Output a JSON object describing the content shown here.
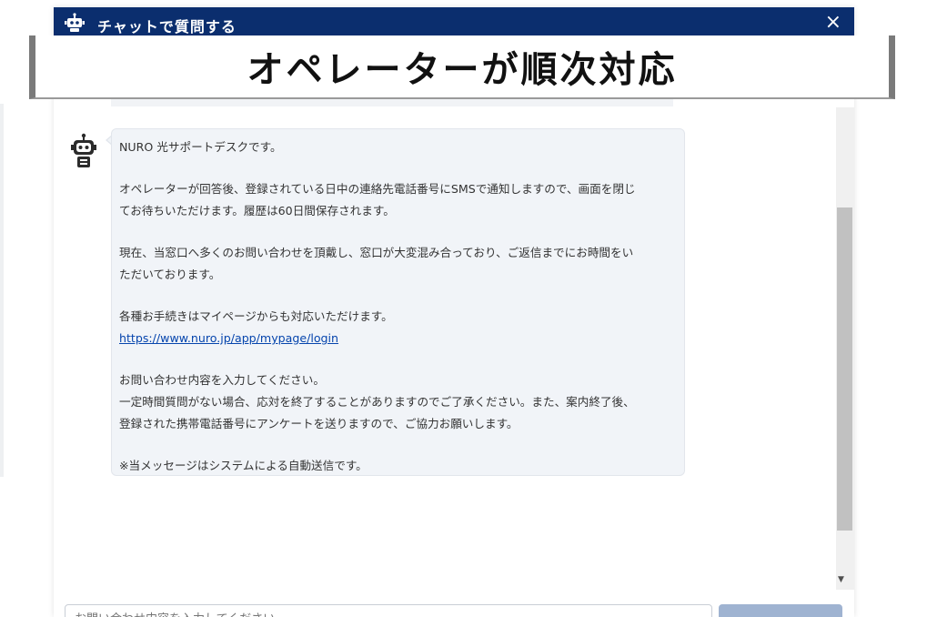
{
  "window": {
    "title": "チャットで質問する",
    "close_label": "×"
  },
  "banner": {
    "text": "オペレーターが順次対応"
  },
  "message": {
    "lines": [
      "NURO 光サポートデスクです。",
      "",
      "オペレーターが回答後、登録されている日中の連絡先電話番号にSMSで通知しますので、画面を閉じ",
      "てお待ちいただけます。履歴は60日間保存されます。",
      "",
      "現在、当窓口へ多くのお問い合わせを頂戴し、窓口が大変混み合っており、ご返信までにお時間をい",
      "ただいております。",
      "",
      "各種お手続きはマイページからも対応いただけます。",
      "https://www.nuro.jp/app/mypage/login",
      "",
      "お問い合わせ内容を入力してください。",
      "一定時間質問がない場合、応対を終了することがありますのでご了承ください。また、案内終了後、",
      "登録された携帯電話番号にアンケートを送りますので、ご協力お願いします。",
      "",
      "※当メッセージはシステムによる自動送信です。"
    ]
  },
  "input": {
    "placeholder": "お問い合わせ内容を入力してください"
  },
  "icons": {
    "title_icon": "robot-icon",
    "avatar": "robot-icon",
    "close": "close-icon",
    "scroll_down": "chevron-down-icon"
  },
  "colors": {
    "titlebar": "#0b2e6e",
    "bubble": "#f1f4f8",
    "link": "#0645ad",
    "send_button": "#9fb3d1"
  }
}
